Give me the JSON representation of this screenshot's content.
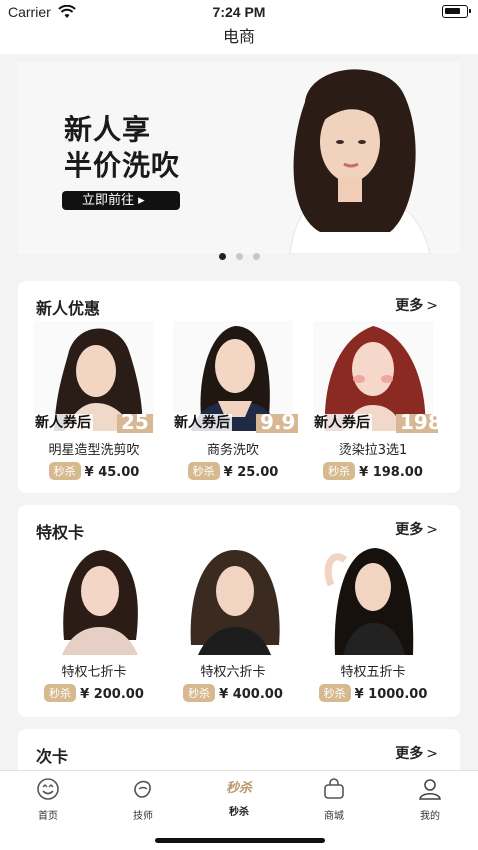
{
  "status": {
    "carrier": "Carrier",
    "time": "7:24 PM"
  },
  "navbar": {
    "title": "电商"
  },
  "banner": {
    "headline_line1": "新人享",
    "headline_line2": "半价洗吹",
    "cta": "立即前往 ▸",
    "active_dot": 0,
    "dot_count": 3
  },
  "sections": {
    "newuser": {
      "title": "新人优惠",
      "more": "更多",
      "items": [
        {
          "coupon_label": "新人券后",
          "coupon_price": "25",
          "name": "明星造型洗剪吹",
          "tag": "秒杀",
          "price": "¥ 45.00",
          "hair": "#2a1d17"
        },
        {
          "coupon_label": "新人券后",
          "coupon_price": "9.9",
          "name": "商务洗吹",
          "tag": "秒杀",
          "price": "¥ 25.00",
          "hair": "#201612"
        },
        {
          "coupon_label": "新人券后",
          "coupon_price": "198",
          "name": "烫染拉3选1",
          "tag": "秒杀",
          "price": "¥ 198.00",
          "hair": "#8a2a22"
        }
      ]
    },
    "vip": {
      "title": "特权卡",
      "more": "更多",
      "items": [
        {
          "name": "特权七折卡",
          "tag": "秒杀",
          "price": "¥ 200.00",
          "hair": "#2b1c15"
        },
        {
          "name": "特权六折卡",
          "tag": "秒杀",
          "price": "¥ 400.00",
          "hair": "#3a2a20"
        },
        {
          "name": "特权五折卡",
          "tag": "秒杀",
          "price": "¥ 1000.00",
          "hair": "#17110e"
        }
      ]
    },
    "times": {
      "title": "次卡",
      "more": "更多"
    }
  },
  "tabbar": {
    "items": [
      {
        "label": "首页",
        "icon": "smile-icon"
      },
      {
        "label": "技师",
        "icon": "stylist-icon"
      },
      {
        "label": "秒杀",
        "icon": "flash-sale-icon",
        "badge": "秒杀",
        "active": true
      },
      {
        "label": "商城",
        "icon": "shop-bag-icon"
      },
      {
        "label": "我的",
        "icon": "profile-icon"
      }
    ]
  },
  "colors": {
    "accent": "#d6b98f",
    "text": "#222222",
    "background": "#f3f3f3"
  }
}
